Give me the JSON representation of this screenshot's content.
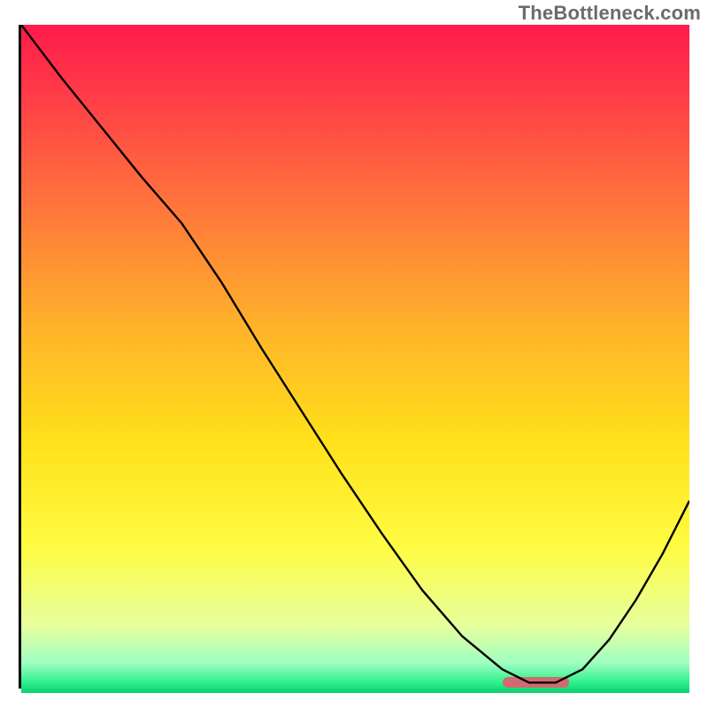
{
  "watermark": "TheBottleneck.com",
  "chart_data": {
    "type": "line",
    "title": "",
    "xlabel": "",
    "ylabel": "",
    "xlim": [
      0,
      100
    ],
    "ylim": [
      0,
      100
    ],
    "grid": false,
    "legend": false,
    "gradient_stops": [
      {
        "offset": 0,
        "color": "#ff1a4b"
      },
      {
        "offset": 0.1,
        "color": "#ff3a48"
      },
      {
        "offset": 0.25,
        "color": "#ff6e3e"
      },
      {
        "offset": 0.45,
        "color": "#ffb22a"
      },
      {
        "offset": 0.62,
        "color": "#ffe01a"
      },
      {
        "offset": 0.78,
        "color": "#fffc42"
      },
      {
        "offset": 0.9,
        "color": "#e7ff9e"
      },
      {
        "offset": 0.955,
        "color": "#9fffc0"
      },
      {
        "offset": 0.985,
        "color": "#2cf08c"
      },
      {
        "offset": 1.0,
        "color": "#0acf6e"
      }
    ],
    "series": [
      {
        "name": "bottleneck-curve",
        "x": [
          0,
          6,
          12,
          18,
          24,
          30,
          36,
          42,
          48,
          54,
          60,
          66,
          72,
          76,
          80,
          84,
          88,
          92,
          96,
          100
        ],
        "y": [
          100,
          92,
          84.5,
          77,
          70,
          61,
          51,
          41.5,
          32,
          23,
          14.5,
          7.5,
          2.5,
          0.5,
          0.5,
          2.5,
          7,
          13,
          20,
          28
        ]
      }
    ],
    "marker": {
      "x_start": 72,
      "x_end": 82,
      "y": 0.6,
      "color": "#d26a6f"
    }
  }
}
